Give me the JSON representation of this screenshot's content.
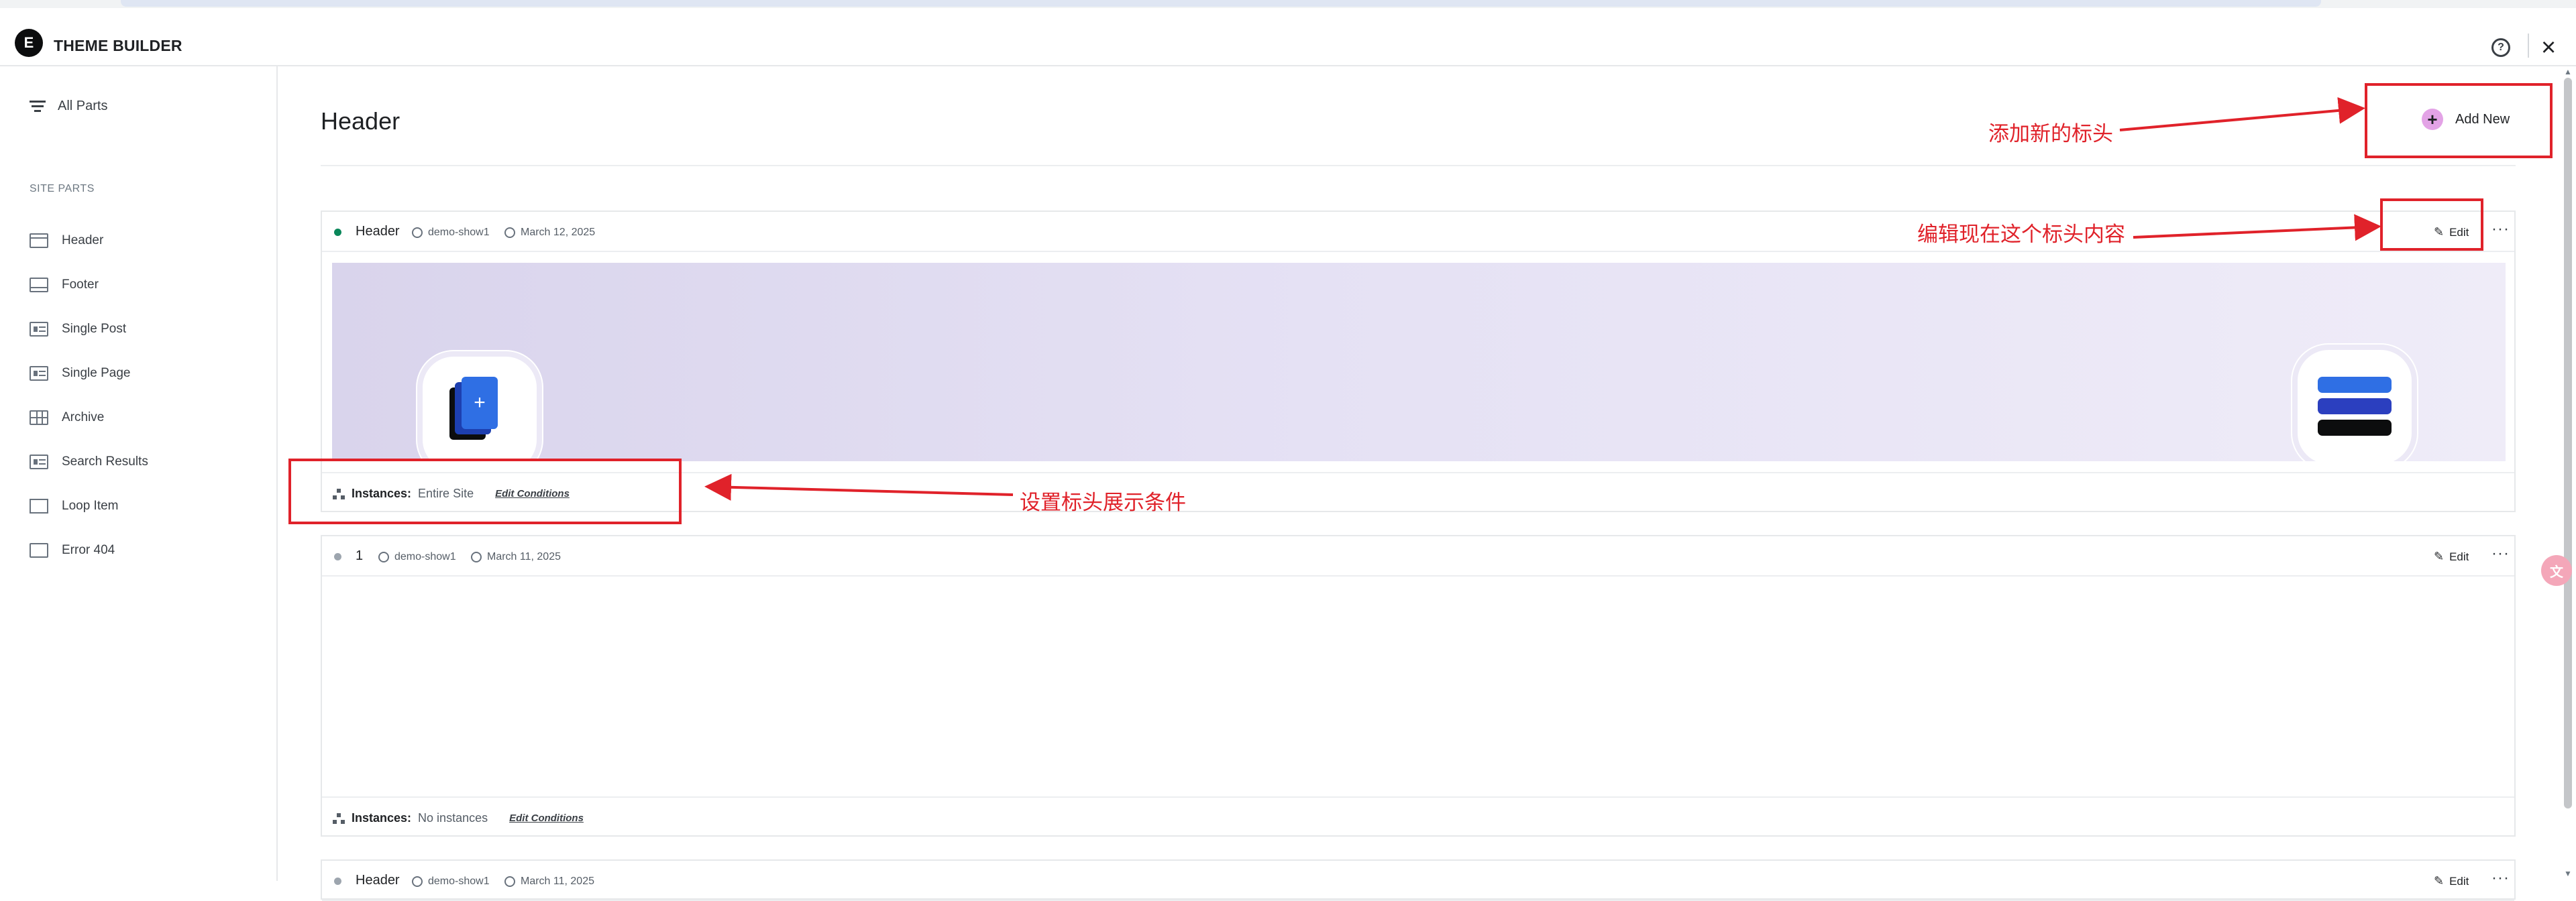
{
  "app": {
    "title": "THEME BUILDER",
    "logo": "E"
  },
  "toolbar": {
    "help_icon": "question-icon",
    "close_icon": "close-icon"
  },
  "sidebar": {
    "all_parts": "All Parts",
    "section": "SITE PARTS",
    "items": [
      {
        "label": "Header",
        "icon": "header-layout-icon"
      },
      {
        "label": "Footer",
        "icon": "footer-layout-icon"
      },
      {
        "label": "Single Post",
        "icon": "single-post-icon"
      },
      {
        "label": "Single Page",
        "icon": "single-page-icon"
      },
      {
        "label": "Archive",
        "icon": "archive-icon"
      },
      {
        "label": "Search Results",
        "icon": "search-results-icon"
      },
      {
        "label": "Loop Item",
        "icon": "loop-item-icon"
      },
      {
        "label": "Error 404",
        "icon": "error-404-icon"
      }
    ]
  },
  "main": {
    "title": "Header",
    "add_new": "Add New",
    "cards": [
      {
        "name": "Header",
        "status": "active",
        "status_color": "#0a875a",
        "author": "demo-show1",
        "date": "March 12, 2025",
        "edit": "Edit",
        "instances_label": "Instances:",
        "instances_value": "Entire Site",
        "edit_conditions": "Edit Conditions"
      },
      {
        "name": "1",
        "status": "inactive",
        "status_color": "#9da5ae",
        "author": "demo-show1",
        "date": "March 11, 2025",
        "edit": "Edit",
        "instances_label": "Instances:",
        "instances_value": "No instances",
        "edit_conditions": "Edit Conditions"
      },
      {
        "name": "Header",
        "status": "inactive",
        "status_color": "#9da5ae",
        "author": "demo-show1",
        "date": "March 11, 2025",
        "edit": "Edit"
      }
    ]
  },
  "annotations": {
    "add_new": "添加新的标头",
    "edit": "编辑现在这个标头内容",
    "conditions": "设置标头展示条件",
    "color": "#e0222a"
  },
  "widgets": {
    "translate": "文"
  }
}
